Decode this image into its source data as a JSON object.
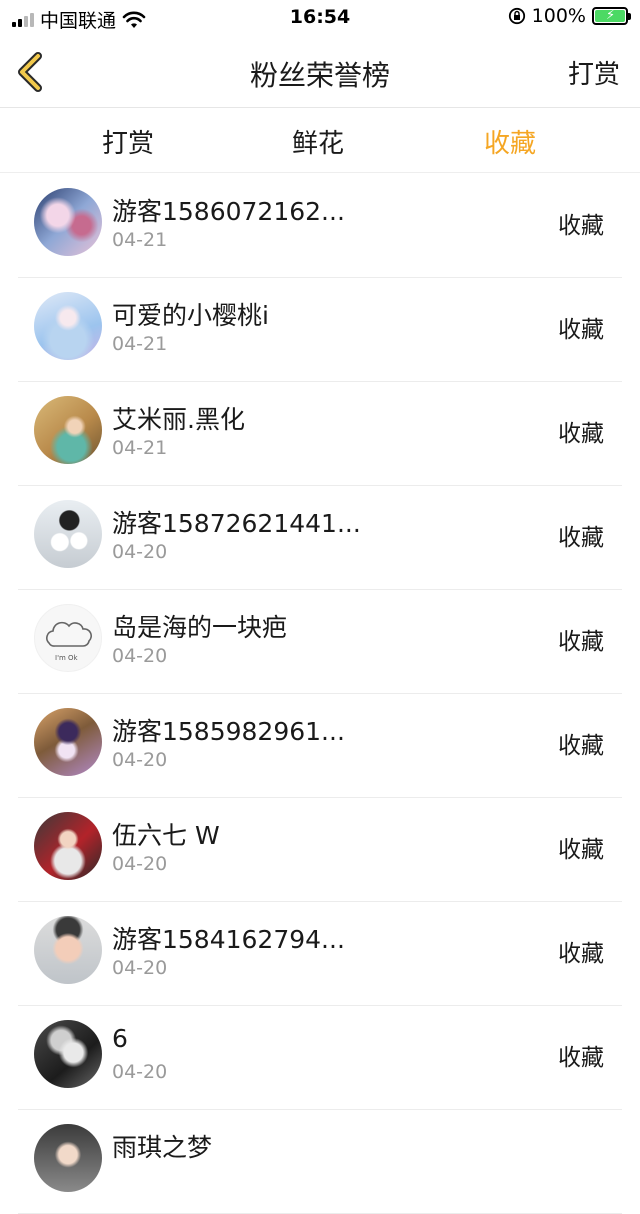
{
  "status_bar": {
    "carrier": "中国联通",
    "time": "16:54",
    "battery": "100%"
  },
  "nav": {
    "title": "粉丝荣誉榜",
    "action": "打赏"
  },
  "tabs": [
    {
      "label": "打赏",
      "active": false
    },
    {
      "label": "鲜花",
      "active": false
    },
    {
      "label": "收藏",
      "active": true
    }
  ],
  "colors": {
    "accent": "#f5a623",
    "back_arrow_fill": "#f2c94c",
    "secondary_text": "#9a9a9a"
  },
  "fans": [
    {
      "name": "游客1586072162...",
      "date": "04-21",
      "action": "收藏",
      "avatar": "anime-girls-avatar"
    },
    {
      "name": "可爱的小樱桃i",
      "date": "04-21",
      "action": "收藏",
      "avatar": "anime-miku-avatar"
    },
    {
      "name": "艾米丽.黑化",
      "date": "04-21",
      "action": "收藏",
      "avatar": "anime-princess-avatar"
    },
    {
      "name": "游客15872621441...",
      "date": "04-20",
      "action": "收藏",
      "avatar": "penguins-avatar"
    },
    {
      "name": "岛是海的一块疤",
      "date": "04-20",
      "action": "收藏",
      "avatar": "cloud-im-ok-avatar"
    },
    {
      "name": "游客1585982961...",
      "date": "04-20",
      "action": "收藏",
      "avatar": "anime-character-avatar"
    },
    {
      "name": "伍六七 W",
      "date": "04-20",
      "action": "收藏",
      "avatar": "cartoon-boy-avatar"
    },
    {
      "name": "游客1584162794...",
      "date": "04-20",
      "action": "收藏",
      "avatar": "child-photo-avatar"
    },
    {
      "name": "6",
      "date": "04-20",
      "action": "收藏",
      "avatar": "bw-portrait-avatar"
    },
    {
      "name": "雨琪之梦",
      "date": "",
      "action": "",
      "avatar": "partial-avatar"
    }
  ]
}
